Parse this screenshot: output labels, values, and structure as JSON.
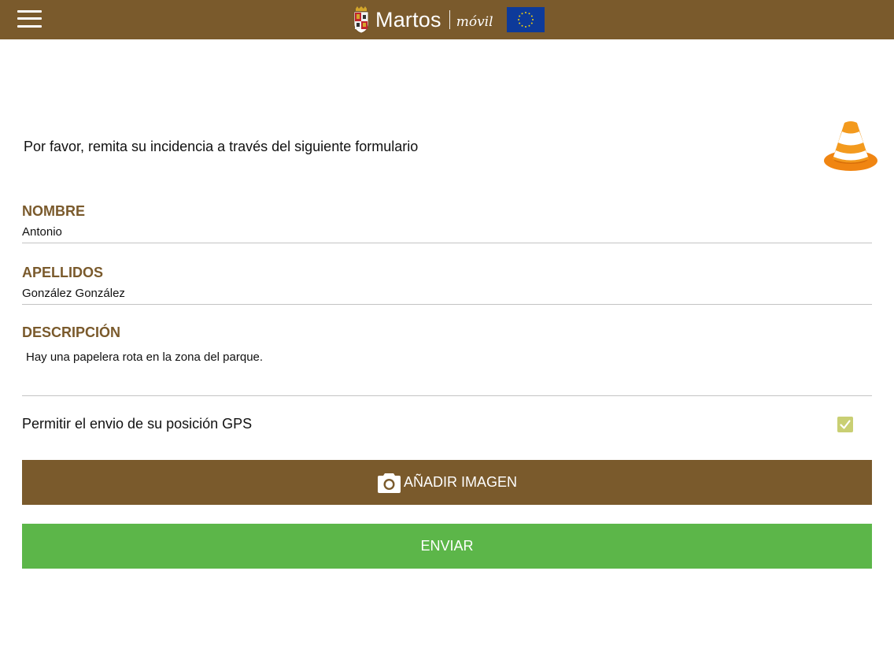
{
  "header": {
    "brand_name": "Martos",
    "brand_sub": "móvil",
    "icons": [
      "menu-icon",
      "crest-icon",
      "eu-flag-icon"
    ],
    "colors": {
      "brand": "#7a5a2c",
      "send": "#5cb649"
    }
  },
  "form": {
    "intro": "Por favor, remita su incidencia a través del siguiente formulario",
    "intro_icon": "traffic-cone-icon",
    "nombre": {
      "label": "NOMBRE",
      "value": "Antonio"
    },
    "apellidos": {
      "label": "APELLIDOS",
      "value": "González González"
    },
    "descripcion": {
      "label": "DESCRIPCIÓN",
      "value": "Hay una papelera rota en la zona del parque."
    },
    "gps": {
      "label": "Permitir el envio de su posición GPS",
      "checked": true
    },
    "add_image_label": "AÑADIR IMAGEN",
    "add_image_icon": "camera-icon",
    "send_label": "ENVIAR"
  }
}
